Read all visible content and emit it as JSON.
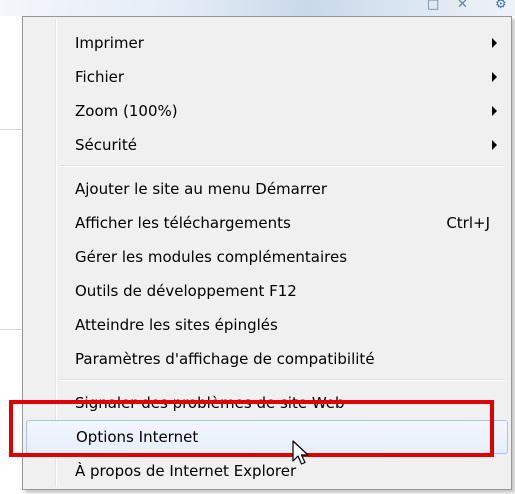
{
  "chrome": {
    "restore_glyph": "□",
    "close_glyph": "✕",
    "tools_glyph": "⚙"
  },
  "menu": {
    "groups": [
      {
        "items": [
          {
            "label": "Imprimer",
            "submenu": true
          },
          {
            "label": "Fichier",
            "submenu": true
          },
          {
            "label": "Zoom (100%)",
            "submenu": true
          },
          {
            "label": "Sécurité",
            "submenu": true
          }
        ]
      },
      {
        "items": [
          {
            "label": "Ajouter le site au menu Démarrer"
          },
          {
            "label": "Afficher les téléchargements",
            "shortcut": "Ctrl+J"
          },
          {
            "label": "Gérer les modules complémentaires"
          },
          {
            "label": "Outils de développement F12"
          },
          {
            "label": "Atteindre les sites épinglés"
          },
          {
            "label": "Paramètres d'affichage de compatibilité"
          }
        ]
      },
      {
        "items": [
          {
            "label": "Signaler des problèmes de site Web"
          },
          {
            "label": "Options Internet",
            "hovered": true
          },
          {
            "label": "À propos de Internet Explorer"
          }
        ]
      }
    ]
  },
  "annotation": {
    "highlight_color": "#e00000",
    "highlighted_item": "Options Internet"
  },
  "icons": {
    "submenu": "chevron-right-icon",
    "cursor": "mouse-pointer-icon"
  }
}
